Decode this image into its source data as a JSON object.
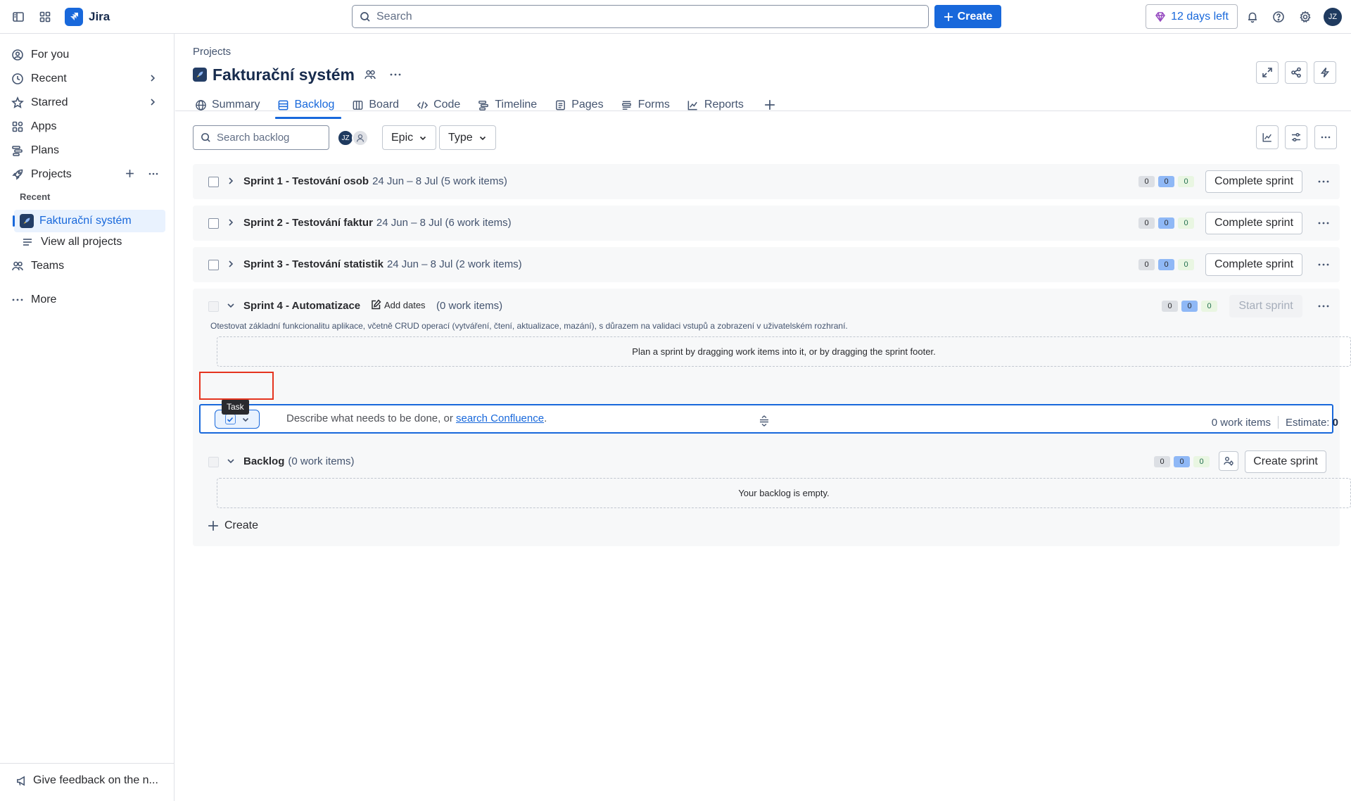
{
  "app": {
    "name": "Jira"
  },
  "topbar": {
    "search_placeholder": "Search",
    "create_label": "Create",
    "trial_label": "12 days left",
    "avatar_initials": "JZ"
  },
  "sidebar": {
    "items": [
      {
        "label": "For you",
        "icon": "user-circle-icon"
      },
      {
        "label": "Recent",
        "icon": "clock-icon"
      },
      {
        "label": "Starred",
        "icon": "star-icon"
      },
      {
        "label": "Apps",
        "icon": "apps-icon"
      },
      {
        "label": "Plans",
        "icon": "plans-icon"
      },
      {
        "label": "Projects",
        "icon": "rocket-icon"
      }
    ],
    "section_recent": "Recent",
    "active_project": "Fakturační systém",
    "view_all": "View all projects",
    "teams": "Teams",
    "more": "More",
    "feedback": "Give feedback on the n..."
  },
  "main": {
    "breadcrumb": "Projects",
    "title": "Fakturační systém",
    "tabs": [
      {
        "label": "Summary",
        "icon": "globe-icon"
      },
      {
        "label": "Backlog",
        "icon": "backlog-icon",
        "active": true
      },
      {
        "label": "Board",
        "icon": "board-icon"
      },
      {
        "label": "Code",
        "icon": "code-icon"
      },
      {
        "label": "Timeline",
        "icon": "timeline-icon"
      },
      {
        "label": "Pages",
        "icon": "pages-icon"
      },
      {
        "label": "Forms",
        "icon": "forms-icon"
      },
      {
        "label": "Reports",
        "icon": "reports-icon"
      }
    ]
  },
  "toolbar": {
    "search_placeholder": "Search backlog",
    "avatar_initials": "JZ",
    "epic_label": "Epic",
    "type_label": "Type"
  },
  "sprints": [
    {
      "name": "Sprint 1 - Testování osob",
      "meta": "24 Jun – 8 Jul (5 work items)",
      "counts": [
        "0",
        "0",
        "0"
      ],
      "action": "Complete sprint"
    },
    {
      "name": "Sprint 2 - Testování faktur",
      "meta": "24 Jun – 8 Jul (6 work items)",
      "counts": [
        "0",
        "0",
        "0"
      ],
      "action": "Complete sprint"
    },
    {
      "name": "Sprint 3 - Testování statistik",
      "meta": "24 Jun – 8 Jul (2 work items)",
      "counts": [
        "0",
        "0",
        "0"
      ],
      "action": "Complete sprint"
    },
    {
      "name": "Sprint 4 - Automatizace",
      "add_dates": "Add dates",
      "meta": "(0 work items)",
      "counts": [
        "0",
        "0",
        "0"
      ],
      "action": "Start sprint",
      "description": "Otestovat základní funkcionalitu aplikace, včetně CRUD operací (vytváření, čtení, aktualizace, mazání), s důrazem na validaci vstupů a zobrazení v uživatelském rozhraní.",
      "drop_hint": "Plan a sprint by dragging work items into it, or by dragging the sprint footer.",
      "create_placeholder_prefix": "Describe what needs to be done, or ",
      "create_link": "search Confluence",
      "create_suffix": ".",
      "tooltip": "Task",
      "footer_items": "0 work items",
      "footer_estimate_label": "Estimate:",
      "footer_estimate_value": "0"
    }
  ],
  "backlog": {
    "name": "Backlog",
    "meta": "(0 work items)",
    "counts": [
      "0",
      "0",
      "0"
    ],
    "action": "Create sprint",
    "empty": "Your backlog is empty.",
    "create_label": "Create"
  }
}
